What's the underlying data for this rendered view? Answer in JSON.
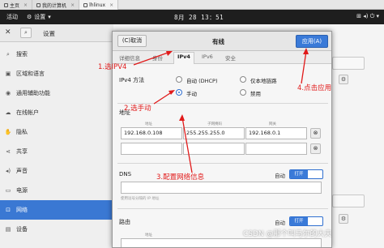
{
  "host_tabs": [
    {
      "label": "主页"
    },
    {
      "label": "我的计算机"
    },
    {
      "label": "lhlinux"
    }
  ],
  "topbar": {
    "activities": "活动",
    "settings_menu": "设置",
    "clock": "8月 28 13：51"
  },
  "settings": {
    "title": "设置"
  },
  "sidebar": {
    "items": [
      {
        "label": "搜索",
        "icon": "search-icon"
      },
      {
        "label": "区域和语言",
        "icon": "camera-icon"
      },
      {
        "label": "通用辅助功能",
        "icon": "accessibility-icon"
      },
      {
        "label": "在线帐户",
        "icon": "online-accounts-icon"
      },
      {
        "label": "隐私",
        "icon": "privacy-hand-icon"
      },
      {
        "label": "共享",
        "icon": "share-icon"
      },
      {
        "label": "声音",
        "icon": "speaker-icon"
      },
      {
        "label": "电源",
        "icon": "power-icon"
      },
      {
        "label": "网络",
        "icon": "network-icon"
      },
      {
        "label": "设备",
        "icon": "devices-icon"
      }
    ]
  },
  "dialog": {
    "cancel": "(C)取消",
    "title": "有线",
    "apply": "应用(A)",
    "tabs": [
      {
        "label": "详细信息"
      },
      {
        "label": "身份"
      },
      {
        "label": "IPv4"
      },
      {
        "label": "IPv6"
      },
      {
        "label": "安全"
      }
    ],
    "ipv4_method_label": "IPv4 方法",
    "methods": [
      {
        "label": "自动 (DHCP)",
        "selected": false
      },
      {
        "label": "仅本地链路",
        "selected": false
      },
      {
        "label": "手动",
        "selected": true
      },
      {
        "label": "禁用",
        "selected": false
      }
    ],
    "address_label": "地址",
    "col_address": "地址",
    "col_netmask": "子网掩码",
    "col_gateway": "网关",
    "row1": {
      "address": "192.168.0.108",
      "netmask": "255.255.255.0",
      "gateway": "192.168.0.1"
    },
    "dns_label": "DNS",
    "auto_label": "自动",
    "toggle_on": "打开",
    "dns_hint": "使用逗号分隔的 IP 地址",
    "route_label": "路由"
  },
  "annotations": {
    "step1": "1.选IPV4",
    "step2": "2.选手动",
    "step3": "3.配置网络信息",
    "step4": "4.点击应用",
    "color": "#e11a1a"
  },
  "watermark": "CSDN @那个叫马尔的大夫"
}
